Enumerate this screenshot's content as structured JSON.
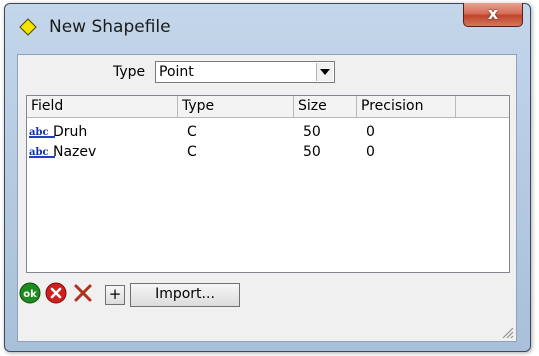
{
  "window": {
    "title": "New Shapefile",
    "close_label": "x"
  },
  "type_selector": {
    "label": "Type",
    "selected": "Point"
  },
  "fields_table": {
    "columns": [
      "Field",
      "Type",
      "Size",
      "Precision"
    ],
    "rows": [
      {
        "icon": "abc-text-icon",
        "field": "Druh",
        "type": "C",
        "size": "50",
        "precision": "0"
      },
      {
        "icon": "abc-text-icon",
        "field": "Nazev",
        "type": "C",
        "size": "50",
        "precision": "0"
      }
    ]
  },
  "toolbar": {
    "ok_icon": "ok-icon",
    "ok_label": "ok",
    "cancel_icon": "cancel-icon",
    "delete_icon": "delete-icon",
    "add_label": "+",
    "import_label": "Import..."
  },
  "colors": {
    "ok": "#1f8a1f",
    "cancel": "#d11f1f",
    "delete": "#b03020",
    "title_icon": "#f4e400"
  }
}
